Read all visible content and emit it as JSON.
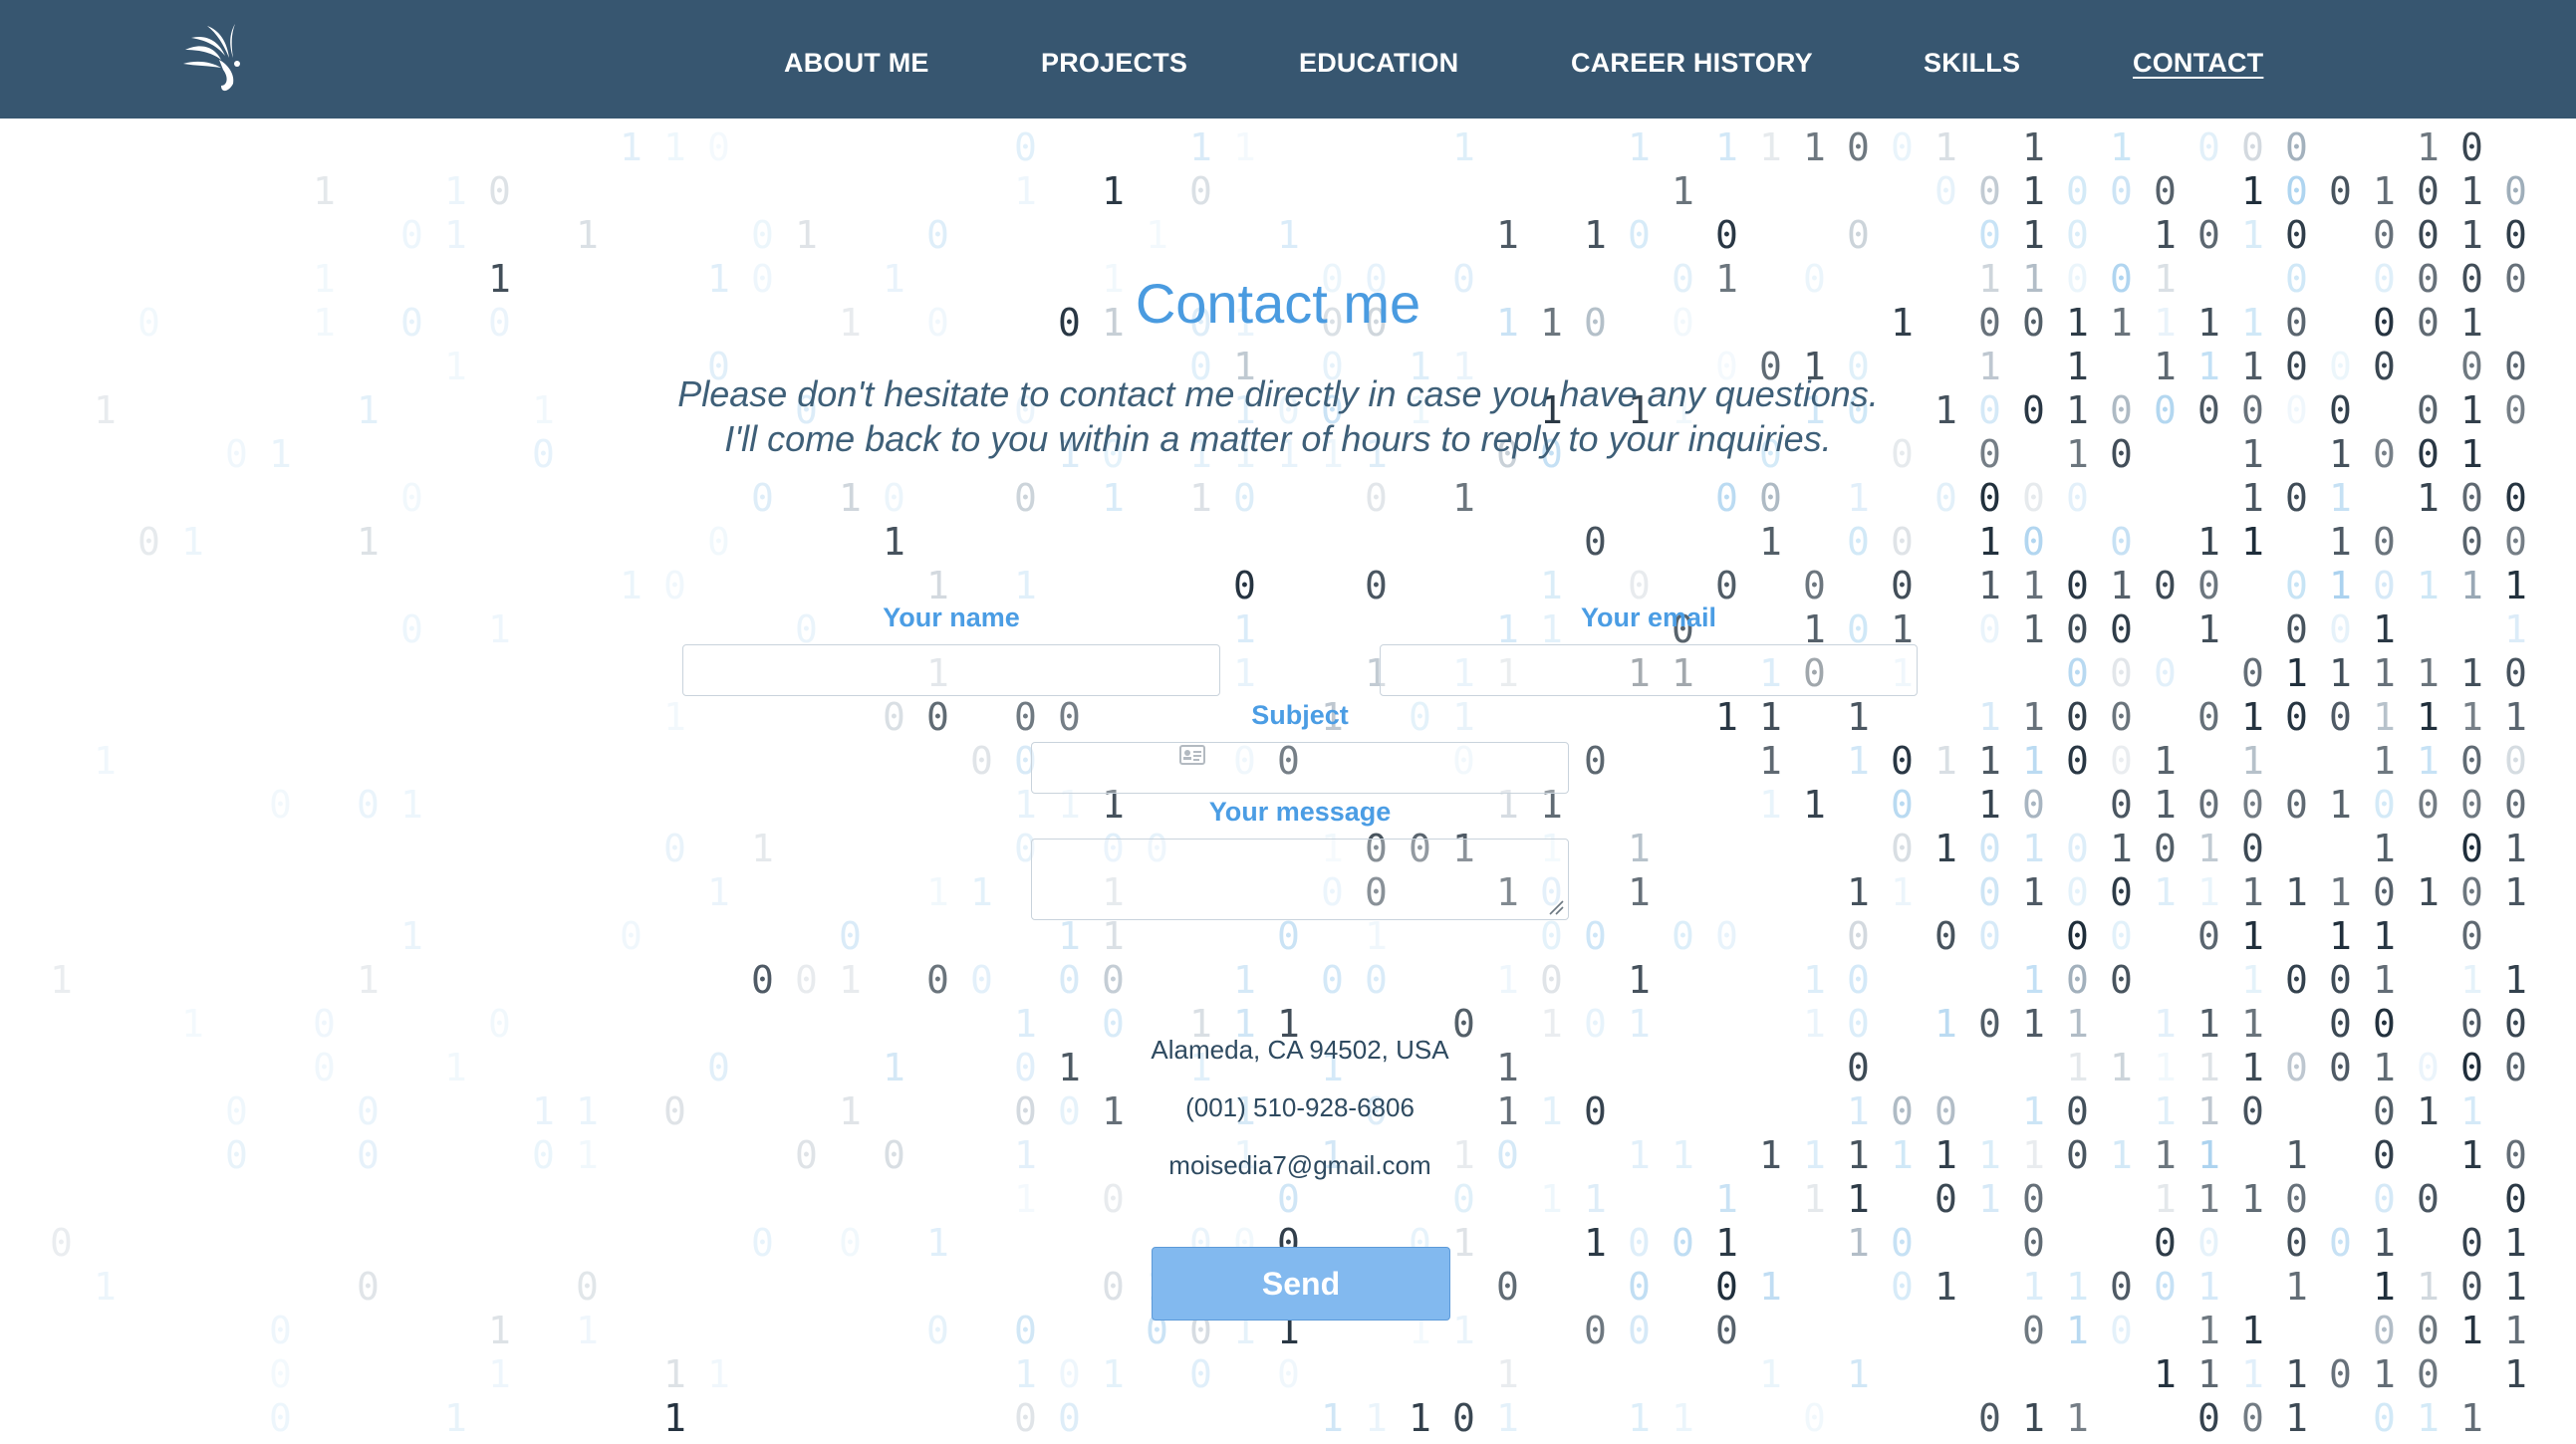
{
  "nav": {
    "items": [
      {
        "label": "ABOUT ME"
      },
      {
        "label": "PROJECTS"
      },
      {
        "label": "EDUCATION"
      },
      {
        "label": "CAREER HISTORY"
      },
      {
        "label": "SKILLS"
      },
      {
        "label": "CONTACT",
        "active": true
      }
    ]
  },
  "contact": {
    "title": "Contact me",
    "intro_line1": "Please don't hesitate to contact me directly in case you have any questions.",
    "intro_line2": "I'll come back to you within a matter of hours to reply to your inquiries."
  },
  "form": {
    "name_label": "Your name",
    "name_value": "",
    "email_label": "Your email",
    "email_value": "",
    "subject_label": "Subject",
    "subject_value": "",
    "message_label": "Your message",
    "message_value": "",
    "send_label": "Send"
  },
  "info": {
    "address": "Alameda, CA 94502, USA",
    "phone": "(001) 510-928-6806",
    "email": "moisedia7@gmail.com"
  },
  "theme": {
    "navbar_bg": "#375670",
    "accent": "#4a9be0",
    "button_bg": "#82b9ef"
  },
  "icons": {
    "logo": "stylized-bird-logo",
    "name_field": "contact-card-icon"
  }
}
